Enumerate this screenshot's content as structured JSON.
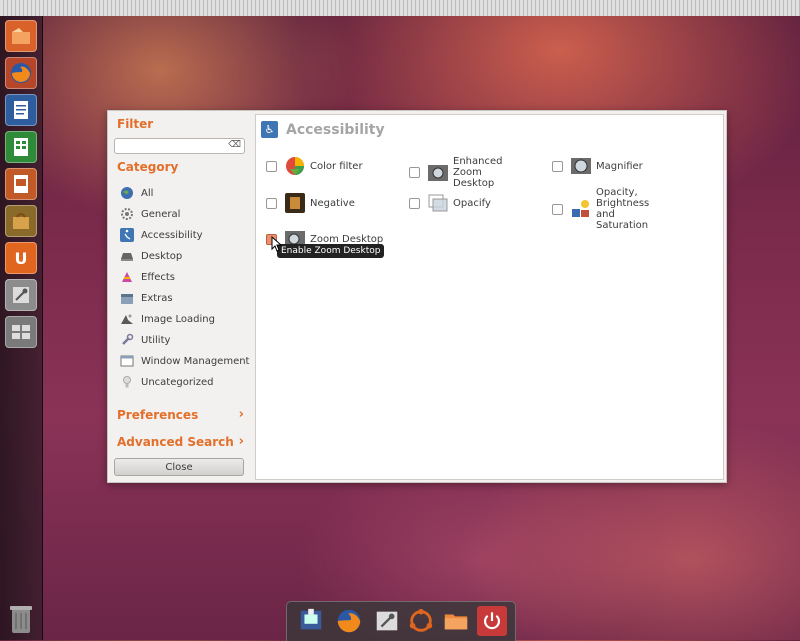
{
  "sidebar": {
    "filter_heading": "Filter",
    "search": {
      "value": "",
      "placeholder": ""
    },
    "category_heading": "Category",
    "categories": [
      {
        "label": "All",
        "icon": "globe-icon"
      },
      {
        "label": "General",
        "icon": "gear-icon"
      },
      {
        "label": "Accessibility",
        "icon": "accessibility-icon"
      },
      {
        "label": "Desktop",
        "icon": "desktop-icon"
      },
      {
        "label": "Effects",
        "icon": "effects-icon"
      },
      {
        "label": "Extras",
        "icon": "extras-icon"
      },
      {
        "label": "Image Loading",
        "icon": "image-loading-icon"
      },
      {
        "label": "Utility",
        "icon": "utility-icon"
      },
      {
        "label": "Window Management",
        "icon": "window-management-icon"
      },
      {
        "label": "Uncategorized",
        "icon": "uncategorized-icon"
      }
    ],
    "preferences_label": "Preferences",
    "advanced_search_label": "Advanced Search",
    "close_label": "Close"
  },
  "main": {
    "title": "Accessibility",
    "plugins": [
      {
        "label": "Color filter",
        "checked": false
      },
      {
        "label": "Enhanced Zoom Desktop",
        "checked": false
      },
      {
        "label": "Magnifier",
        "checked": false
      },
      {
        "label": "Negative",
        "checked": false
      },
      {
        "label": "Opacify",
        "checked": false
      },
      {
        "label": "Opacity, Brightness and Saturation",
        "checked": false
      },
      {
        "label": "Zoom Desktop",
        "checked": true
      }
    ],
    "tooltip": "Enable Zoom Desktop"
  },
  "colors": {
    "accent": "#e36f2a",
    "launcher": "#3c1e2d"
  }
}
